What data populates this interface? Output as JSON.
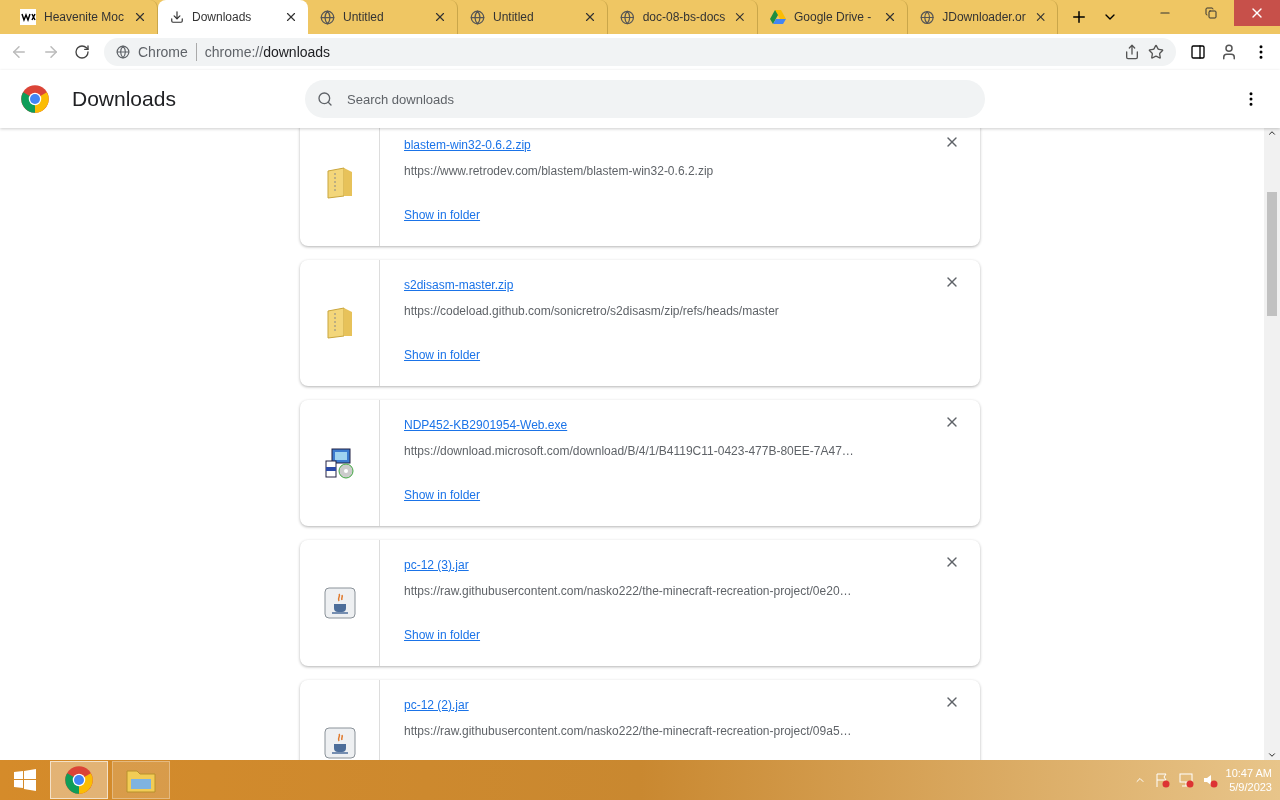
{
  "tabs": [
    {
      "title": "Heavenite Moc",
      "kind": "wix",
      "selected": false
    },
    {
      "title": "Downloads",
      "kind": "download",
      "selected": true
    },
    {
      "title": "Untitled",
      "kind": "globe",
      "selected": false
    },
    {
      "title": "Untitled",
      "kind": "globe",
      "selected": false
    },
    {
      "title": "doc-08-bs-docs",
      "kind": "globe",
      "selected": false
    },
    {
      "title": "Google Drive -",
      "kind": "drive",
      "selected": false
    },
    {
      "title": "JDownloader.or",
      "kind": "globe",
      "selected": false
    }
  ],
  "address_bar": {
    "site_label": "Chrome",
    "url_prefix": "chrome://",
    "url_path": "downloads"
  },
  "header": {
    "title": "Downloads",
    "search_placeholder": "Search downloads"
  },
  "downloads": [
    {
      "file_name": "blastem-win32-0.6.2.zip",
      "url": "https://www.retrodev.com/blastem/blastem-win32-0.6.2.zip",
      "action": "Show in folder",
      "kind": "zip"
    },
    {
      "file_name": "s2disasm-master.zip",
      "url": "https://codeload.github.com/sonicretro/s2disasm/zip/refs/heads/master",
      "action": "Show in folder",
      "kind": "zip"
    },
    {
      "file_name": "NDP452-KB2901954-Web.exe",
      "url": "https://download.microsoft.com/download/B/4/1/B4119C11-0423-477B-80EE-7A47…",
      "action": "Show in folder",
      "kind": "installer"
    },
    {
      "file_name": "pc-12 (3).jar",
      "url": "https://raw.githubusercontent.com/nasko222/the-minecraft-recreation-project/0e20…",
      "action": "Show in folder",
      "kind": "jar"
    },
    {
      "file_name": "pc-12 (2).jar",
      "url": "https://raw.githubusercontent.com/nasko222/the-minecraft-recreation-project/09a5…",
      "kind": "jar"
    }
  ],
  "taskbar": {
    "items": [
      {
        "kind": "chrome",
        "selected": true
      },
      {
        "kind": "explorer",
        "selected": false
      }
    ],
    "time": "10:47 AM",
    "date": "5/9/2023"
  }
}
